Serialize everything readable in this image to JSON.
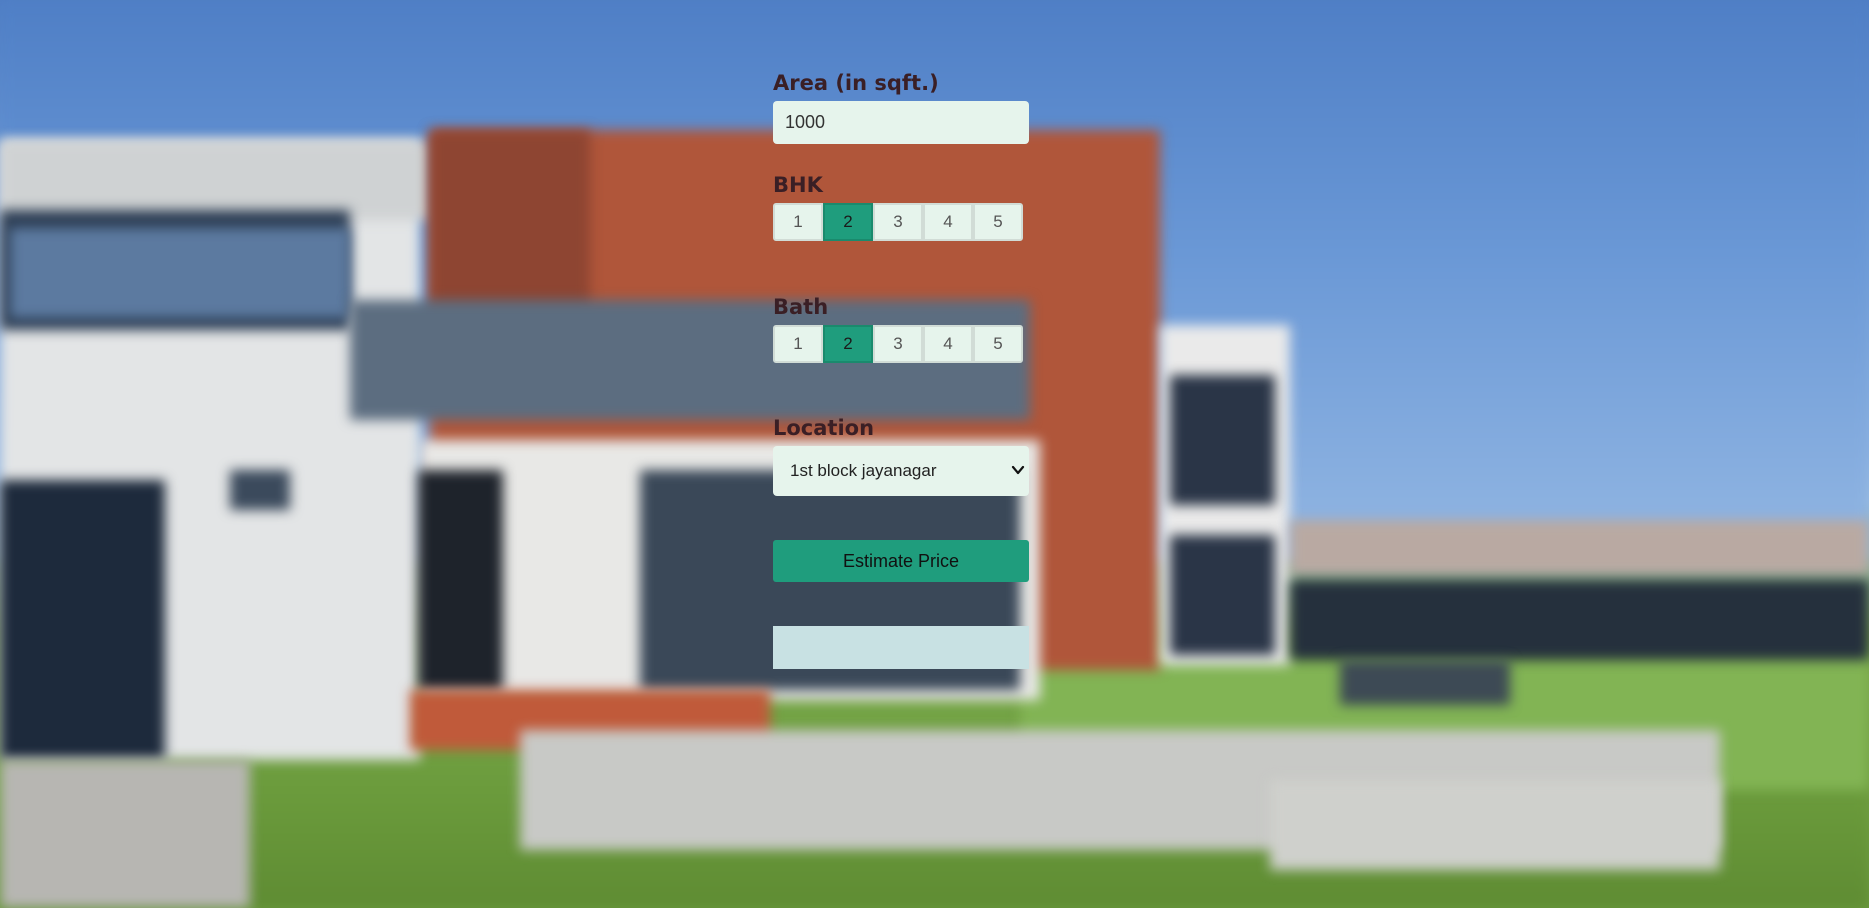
{
  "form": {
    "area_label": "Area (in sqft.)",
    "area_value": "1000",
    "bhk_label": "BHK",
    "bhk_options": [
      "1",
      "2",
      "3",
      "4",
      "5"
    ],
    "bhk_selected": "2",
    "bath_label": "Bath",
    "bath_options": [
      "1",
      "2",
      "3",
      "4",
      "5"
    ],
    "bath_selected": "2",
    "location_label": "Location",
    "location_selected": "1st block jayanagar",
    "estimate_button_label": "Estimate Price",
    "result_text": ""
  },
  "colors": {
    "accent": "#1f9d7d",
    "input_bg": "#e6f4ec",
    "result_bg": "#c8e1e3",
    "label_color": "#3a1f25"
  }
}
